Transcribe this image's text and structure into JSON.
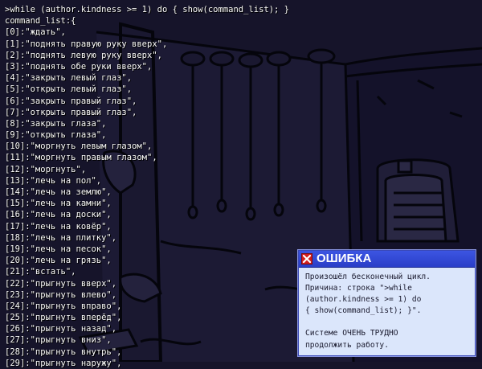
{
  "console": {
    "lines": [
      ">while (author.kindness >= 1) do { show(command_list); }",
      "command_list:{",
      "[0]:\"ждать\",",
      "[1]:\"поднять правую руку вверх\",",
      "[2]:\"поднять левую руку вверх\",",
      "[3]:\"поднять обе руки вверх\",",
      "[4]:\"закрыть левый глаз\",",
      "[5]:\"открыть левый глаз\",",
      "[6]:\"закрыть правый глаз\",",
      "[7]:\"открыть правый глаз\",",
      "[8]:\"закрыть глаза\",",
      "[9]:\"открыть глаза\",",
      "[10]:\"моргнуть левым глазом\",",
      "[11]:\"моргнуть правым глазом\",",
      "[12]:\"моргнуть\",",
      "[13]:\"лечь на пол\",",
      "[14]:\"лечь на землю\",",
      "[15]:\"лечь на камни\",",
      "[16]:\"лечь на доски\",",
      "[17]:\"лечь на ковёр\",",
      "[18]:\"лечь на плитку\",",
      "[19]:\"лечь на песок\",",
      "[20]:\"лечь на грязь\",",
      "[21]:\"встать\",",
      "[22]:\"прыгнуть вверх\",",
      "[23]:\"прыгнуть влево\",",
      "[24]:\"прыгнуть вправо\",",
      "[25]:\"прыгнуть вперёд\",",
      "[26]:\"прыгнуть назад\",",
      "[27]:\"прыгнуть вниз\",",
      "[28]:\"прыгнуть внутрь\",",
      "[29]:\"прыгнуть наружу\","
    ]
  },
  "error_dialog": {
    "title": "ОШИБКА",
    "close_icon": "close-icon",
    "body_lines": [
      "Произошёл бесконечный цикл.",
      "Причина: строка \">while",
      "(author.kindness >= 1) do",
      "{ show(command_list); }\".",
      "",
      "Системе ОЧЕНЬ ТРУДНО",
      "продолжить работу."
    ]
  },
  "colors": {
    "background": "#16142a",
    "console_text": "#ffffff",
    "dialog_titlebar": "#2f44d2",
    "dialog_body": "#dbe6fb",
    "close_button": "#d21d1d"
  }
}
